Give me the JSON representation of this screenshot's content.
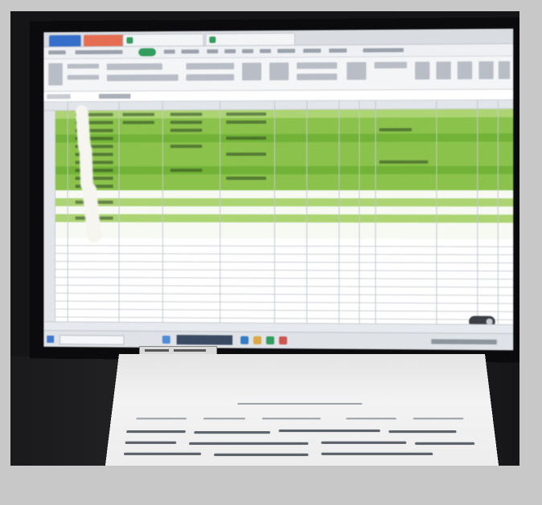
{
  "scene": {
    "description_free": true
  },
  "colors": {
    "background": "#c8c8c8",
    "frame": "#151517",
    "sheet_green": "#86c440",
    "sheet_green_light": "#a9d66a",
    "paper": "#f0f0f0"
  },
  "icons": [
    "windows-start-icon",
    "zoom-toggle-icon"
  ]
}
